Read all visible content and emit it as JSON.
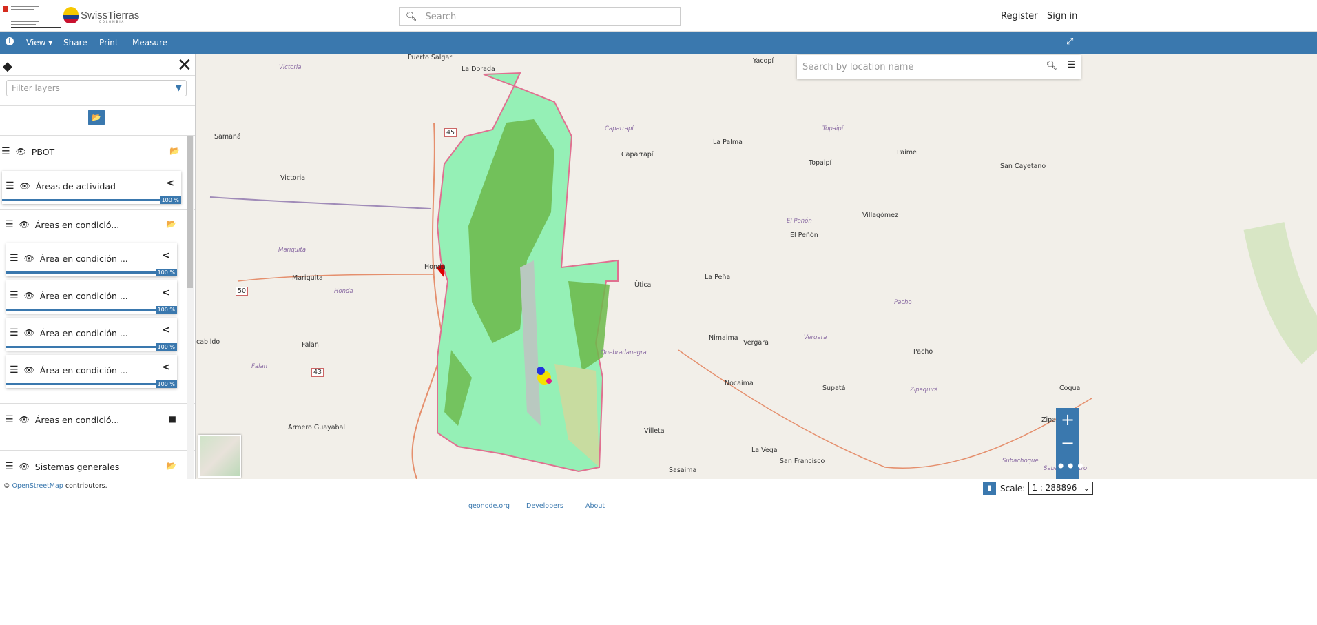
{
  "header": {
    "logo": "SwissTierras",
    "logo_sub": "COLOMBIA",
    "search_placeholder": "Search",
    "register": "Register",
    "sign_in": "Sign in"
  },
  "toolbar": {
    "info_icon": "info-icon",
    "view": "View",
    "share": "Share",
    "print": "Print",
    "measure": "Measure"
  },
  "sidebar": {
    "filter_placeholder": "Filter layers",
    "layers": [
      {
        "label": "PBOT"
      },
      {
        "label": "Áreas de actividad",
        "opacity": "100 %"
      },
      {
        "label": "Áreas en condició..."
      },
      {
        "label": "Área en condición ...",
        "opacity": "100 %"
      },
      {
        "label": "Área en condición ...",
        "opacity": "100 %"
      },
      {
        "label": "Área en condición ...",
        "opacity": "100 %"
      },
      {
        "label": "Área en condición ...",
        "opacity": "100 %"
      },
      {
        "label": "Áreas en condició..."
      },
      {
        "label": "Sistemas generales"
      }
    ]
  },
  "map": {
    "location_placeholder": "Search by location name",
    "places": [
      "Puerto Salgar",
      "La Dorada",
      "Yacopí",
      "Victoria",
      "Samaná",
      "Caparrapí",
      "La Palma",
      "Topaipí",
      "Paime",
      "San Cayetano",
      "Victoria",
      "Villagómez",
      "El Peñón",
      "Honda",
      "Mariquita",
      "Útica",
      "La Peña",
      "Falan",
      "Nimaima",
      "Vergara",
      "Pacho",
      "Quebradanegra",
      "Nocaima",
      "Supatá",
      "Cogua",
      "Zipaquirá",
      "Armero Guayabal",
      "Villeta",
      "La Vega",
      "San Francisco",
      "Sasaima",
      "Sabana Centro",
      "cabildo",
      "Subachoque",
      "Caparrapí",
      "Topaipí",
      "El Peñón",
      "Vergara",
      "Honda",
      "Falan",
      "Mariquita",
      "Pacho",
      "Zipaquirá"
    ],
    "roads": [
      "45",
      "50",
      "43"
    ],
    "fill_color": "#95f0b6",
    "forest_color": "#6cb84a"
  },
  "footer": {
    "attribution_link": "OpenStreetMap",
    "attribution_text": " contributors.",
    "scale_label": "Scale:",
    "scale_value": "1 : 288896",
    "links": [
      "geonode.org",
      "Developers",
      "About"
    ]
  }
}
